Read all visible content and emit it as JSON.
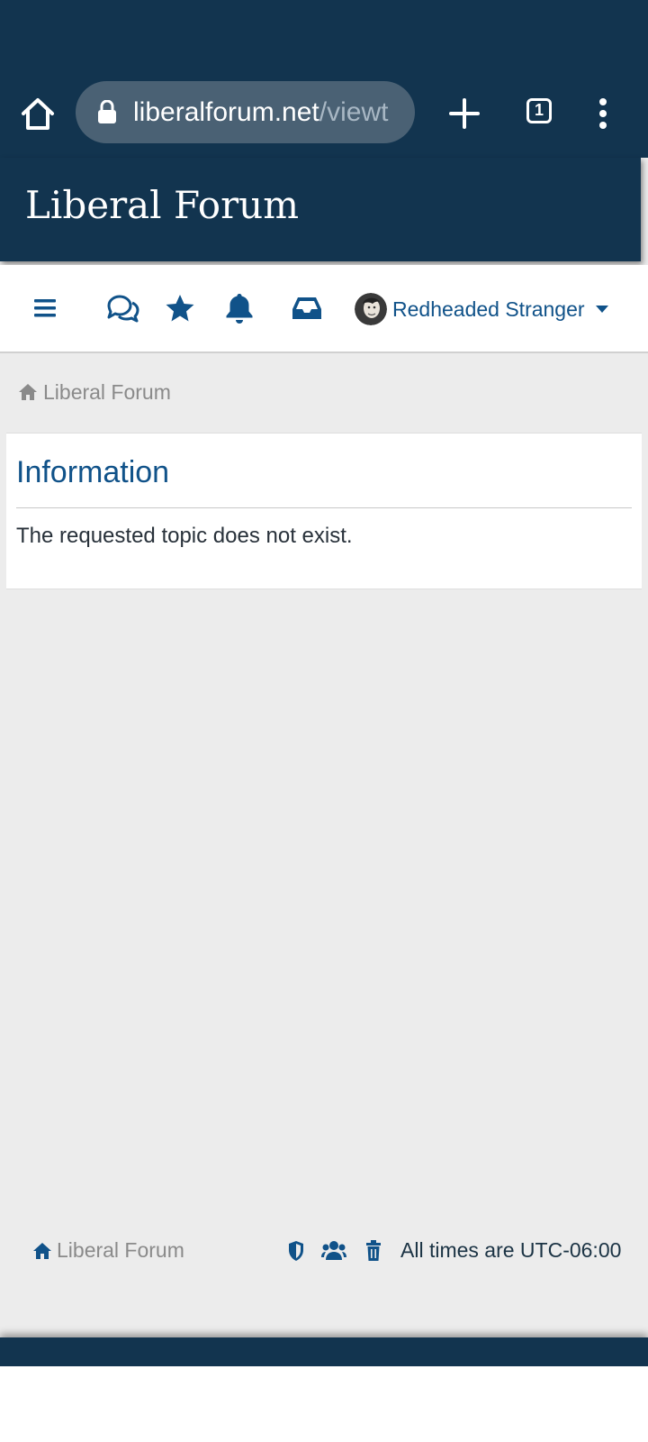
{
  "browser": {
    "url_host": "liberalforum.net",
    "url_path": "/viewt",
    "tab_count": "1",
    "icons": [
      "home-icon",
      "lock-icon",
      "plus-icon",
      "tabs-icon",
      "more-vertical-icon"
    ]
  },
  "site": {
    "title": "Liberal Forum"
  },
  "nav": {
    "icons": [
      "hamburger-menu-icon",
      "chat-bubbles-icon",
      "star-icon",
      "bell-icon",
      "inbox-icon"
    ],
    "username": "Redheaded Stranger"
  },
  "breadcrumb": {
    "home_label": "Liberal Forum"
  },
  "panel": {
    "title": "Information",
    "message": "The requested topic does not exist."
  },
  "footer": {
    "home_label": "Liberal Forum",
    "icons": [
      "shield-icon",
      "users-icon",
      "trash-icon"
    ],
    "timezone": "All times are UTC-06:00"
  },
  "colors": {
    "header_bg": "#12344f",
    "link_blue": "#105289",
    "page_bg": "#ececec"
  }
}
